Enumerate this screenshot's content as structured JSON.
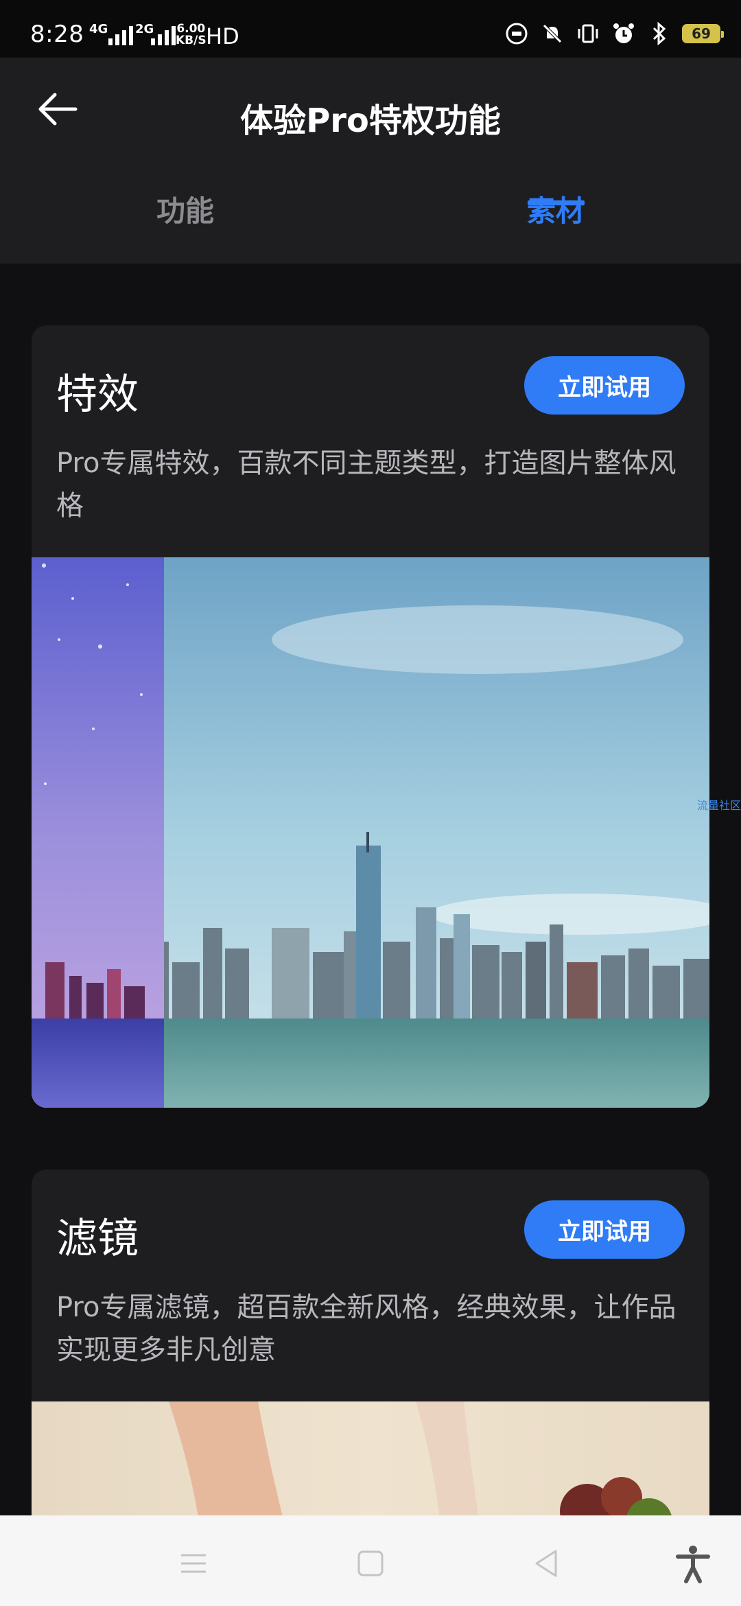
{
  "status_bar": {
    "time": "8:28",
    "network1": "4G",
    "network2": "2G",
    "speed_value": "6.00",
    "speed_unit": "KB/S",
    "hd": "HD",
    "battery": "69"
  },
  "header": {
    "title": "体验Pro特权功能",
    "tabs": [
      {
        "label": "功能",
        "active": false
      },
      {
        "label": "素材",
        "active": true
      }
    ]
  },
  "cards": [
    {
      "title": "特效",
      "button": "立即试用",
      "description": "Pro专属特效，百款不同主题类型，打造图片整体风格"
    },
    {
      "title": "滤镜",
      "button": "立即试用",
      "description": "Pro专属滤镜，超百款全新风格，经典效果，让作品实现更多非凡创意"
    }
  ],
  "watermark": "流量社区",
  "colors": {
    "accent": "#2f7cf6",
    "card_bg": "#1e1e21",
    "page_bg": "#101012"
  },
  "icons": [
    "back-arrow-icon",
    "menu-icon",
    "home-icon",
    "back-icon",
    "accessibility-icon"
  ]
}
